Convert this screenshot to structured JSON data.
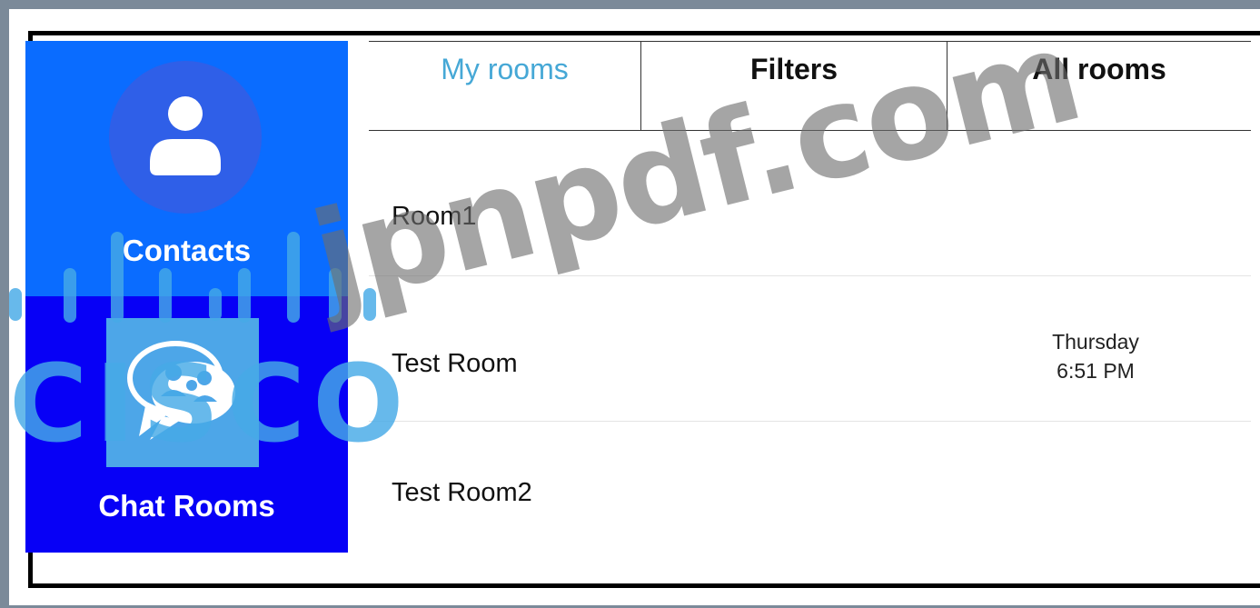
{
  "sidebar": {
    "contacts_label": "Contacts",
    "chat_rooms_label": "Chat Rooms"
  },
  "tabs": [
    {
      "label": "My rooms",
      "active": true
    },
    {
      "label": "Filters",
      "active": false
    },
    {
      "label": "All rooms",
      "active": false
    }
  ],
  "rooms": [
    {
      "name": "Room1",
      "day": "",
      "time": ""
    },
    {
      "name": "Test Room",
      "day": "Thursday",
      "time": "6:51 PM"
    },
    {
      "name": "Test Room2",
      "day": "",
      "time": ""
    }
  ],
  "watermarks": {
    "brand": "jpnpdf.com",
    "cisco": "CISCO"
  },
  "colors": {
    "contacts_bg": "#0a6cff",
    "chat_rooms_bg": "#0700f6",
    "active_tab": "#46a8d6",
    "chat_tile": "#4da6e8"
  },
  "icons": {
    "contacts": "person-icon",
    "chat_rooms": "chat-bubbles-icon"
  }
}
